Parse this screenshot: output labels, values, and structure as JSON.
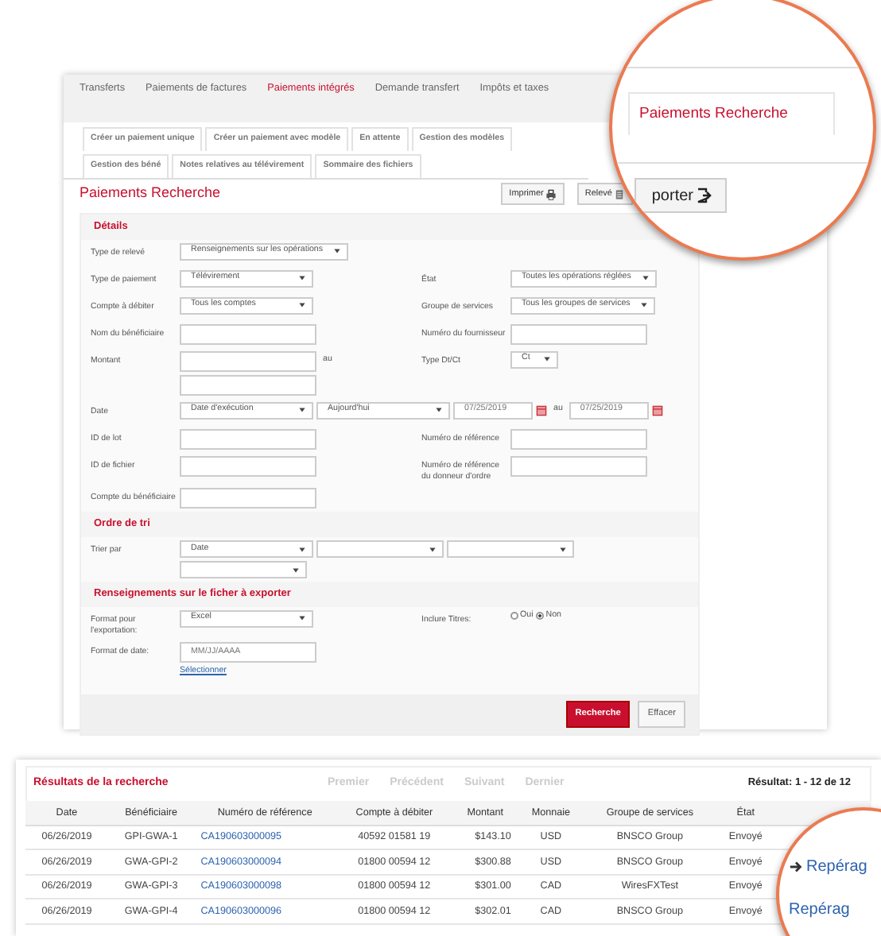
{
  "top_nav": [
    {
      "label": "Transferts",
      "selected": false
    },
    {
      "label": "Paiements de factures",
      "selected": false
    },
    {
      "label": "Paiements intégrés",
      "selected": true
    },
    {
      "label": "Demande transfert",
      "selected": false
    },
    {
      "label": "Impôts et taxes",
      "selected": false
    }
  ],
  "sub_tabs": [
    "Créer un paiement unique",
    "Créer un paiement avec modèle",
    "En attente",
    "Gestion des modèles",
    "Gestion des béné",
    "Notes relatives au télévirement",
    "Sommaire des fichiers"
  ],
  "page_title": "Paiements Recherche",
  "toolbar_buttons": [
    {
      "label": "Imprimer",
      "kind": "print"
    },
    {
      "label": "Relevé",
      "kind": "document"
    }
  ],
  "sections": [
    {
      "title": "Détails",
      "rows": [
        {
          "kind": "pair",
          "left": {
            "label": "Type de relevé",
            "controls": [
              {
                "kind": "select",
                "value": "Renseignements sur les opérations"
              }
            ]
          }
        },
        {
          "kind": "pair",
          "left": {
            "label": "Type de paiement",
            "controls": [
              {
                "kind": "select",
                "value": "Télévirement"
              }
            ]
          },
          "right": {
            "label": "État",
            "controls": [
              {
                "kind": "select",
                "value": "Toutes les opérations réglées"
              }
            ]
          }
        },
        {
          "kind": "pair",
          "left": {
            "label": "Compte à débiter",
            "controls": [
              {
                "kind": "select",
                "value": "Tous les comptes"
              }
            ]
          },
          "right": {
            "label": "Groupe de services",
            "controls": [
              {
                "kind": "select",
                "value": "Tous les groupes de services"
              }
            ]
          }
        },
        {
          "kind": "pair",
          "left": {
            "label": "Nom du bénéficiaire",
            "controls": [
              {
                "kind": "input"
              }
            ]
          },
          "right": {
            "label": "Numéro du fournisseur",
            "controls": [
              {
                "kind": "input"
              }
            ]
          }
        },
        {
          "kind": "pair",
          "left": {
            "label": "Montant",
            "controls": [
              {
                "kind": "input"
              },
              {
                "kind": "text",
                "text": "au"
              },
              {
                "kind": "input"
              }
            ]
          },
          "right": {
            "label": "Type Dt/Ct",
            "controls": [
              {
                "kind": "select",
                "value": "Ct"
              }
            ]
          }
        },
        {
          "kind": "wide",
          "left": {
            "label": "Date",
            "controls": [
              {
                "kind": "select",
                "value": "Date d'exécution"
              },
              {
                "kind": "select",
                "value": "Aujourd'hui"
              },
              {
                "kind": "date",
                "value": "07/25/2019"
              },
              {
                "kind": "text",
                "text": "au"
              },
              {
                "kind": "date",
                "value": "07/25/2019"
              }
            ]
          }
        },
        {
          "kind": "pair",
          "left": {
            "label": "ID de lot",
            "controls": [
              {
                "kind": "input"
              }
            ]
          },
          "right": {
            "label": "Numéro de référence",
            "controls": [
              {
                "kind": "input"
              }
            ]
          }
        },
        {
          "kind": "pair",
          "left": {
            "label": "ID de fichier",
            "controls": [
              {
                "kind": "input"
              }
            ]
          },
          "right": {
            "label": "Numéro de référence du donneur d'ordre",
            "controls": [
              {
                "kind": "input"
              }
            ]
          }
        },
        {
          "kind": "pair",
          "left": {
            "label": "Compte du bénéficiaire",
            "controls": [
              {
                "kind": "input"
              }
            ]
          }
        }
      ]
    },
    {
      "title": "Ordre de tri",
      "rows": [
        {
          "kind": "wide",
          "left": {
            "label": "Trier par",
            "controls": [
              {
                "kind": "select",
                "value": "Date"
              },
              {
                "kind": "select"
              },
              {
                "kind": "select"
              },
              {
                "kind": "select"
              }
            ]
          }
        }
      ]
    },
    {
      "title": "Renseignements sur le ficher à exporter",
      "rows": [
        {
          "kind": "pair",
          "left": {
            "label": "Format pour l'exportation:",
            "controls": [
              {
                "kind": "select",
                "value": "Excel"
              }
            ]
          },
          "right": {
            "label": "Inclure Titres:",
            "controls": [
              {
                "kind": "radio",
                "label": "Oui",
                "selected": false
              },
              {
                "kind": "radio",
                "label": "Non",
                "selected": true
              }
            ]
          }
        },
        {
          "kind": "pair",
          "left": {
            "label": "Format de date:",
            "controls": [
              {
                "kind": "input",
                "value": "MM/JJ/AAAA"
              },
              {
                "kind": "link",
                "text": "Sélectionner"
              }
            ]
          }
        }
      ]
    }
  ],
  "form_buttons": [
    {
      "label": "Recherche",
      "kind": "primary"
    },
    {
      "label": "Effacer",
      "kind": "secondary"
    }
  ],
  "results": {
    "title": "Résultats de la recherche",
    "pager": [
      {
        "label": "Premier",
        "disabled": true
      },
      {
        "label": "Précédent",
        "disabled": true
      },
      {
        "label": "Suivant",
        "disabled": true
      },
      {
        "label": "Dernier",
        "disabled": true
      }
    ],
    "count": "Résultat: 1 - 12 de 12",
    "columns": [
      "Date",
      "Bénéficiaire",
      "Numéro de référence",
      "Compte à débiter",
      "Montant",
      "Monnaie",
      "Groupe de services",
      "État"
    ],
    "rows": [
      [
        "06/26/2019",
        "GPI-GWA-1",
        "CA190603000095",
        "40592 01581 19",
        "$143.10",
        "USD",
        "BNSCO Group",
        "Envoyé"
      ],
      [
        "06/26/2019",
        "GWA-GPI-2",
        "CA190603000094",
        "01800 00594 12",
        "$300.88",
        "USD",
        "BNSCO Group",
        "Envoyé"
      ],
      [
        "06/26/2019",
        "GWA-GPI-3",
        "CA190603000098",
        "01800 00594 12",
        "$301.00",
        "CAD",
        "WiresFXTest",
        "Envoyé"
      ],
      [
        "06/26/2019",
        "GWA-GPI-4",
        "CA190603000096",
        "01800 00594 12",
        "$302.01",
        "CAD",
        "BNSCO Group",
        "Envoyé"
      ]
    ]
  },
  "callouts": {
    "tab_label": "Paiements Recherche",
    "button_label": "porter",
    "links": [
      "Repérag",
      "Repérag"
    ]
  }
}
